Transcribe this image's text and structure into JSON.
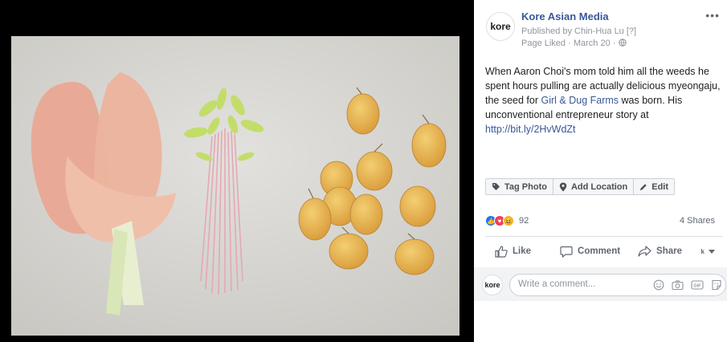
{
  "post": {
    "page_name": "Kore Asian Media",
    "avatar_text": "kore",
    "published_by": "Published by Chin-Hua Lu [?]",
    "page_liked": "Page Liked",
    "date": "March 20",
    "text_part1": "When Aaron Choi's mom told him all the weeds he spent hours pulling are actually delicious myeongaju, the seed for ",
    "text_link": "Girl & Dug Farms",
    "text_part2": " was born. His unconventional entrepreneur story at ",
    "url": "http://bit.ly/2HvWdZt"
  },
  "photo_actions": {
    "tag_photo": "Tag Photo",
    "add_location": "Add Location",
    "edit": "Edit"
  },
  "reactions": {
    "count": "92",
    "shares": "4 Shares"
  },
  "buttons": {
    "like": "Like",
    "comment": "Comment",
    "share": "Share"
  },
  "comment": {
    "placeholder": "Write a comment..."
  },
  "colors": {
    "link": "#385898",
    "like_blue": "#1877f2",
    "love_red": "#f33e58",
    "haha_yellow": "#f7b125"
  }
}
